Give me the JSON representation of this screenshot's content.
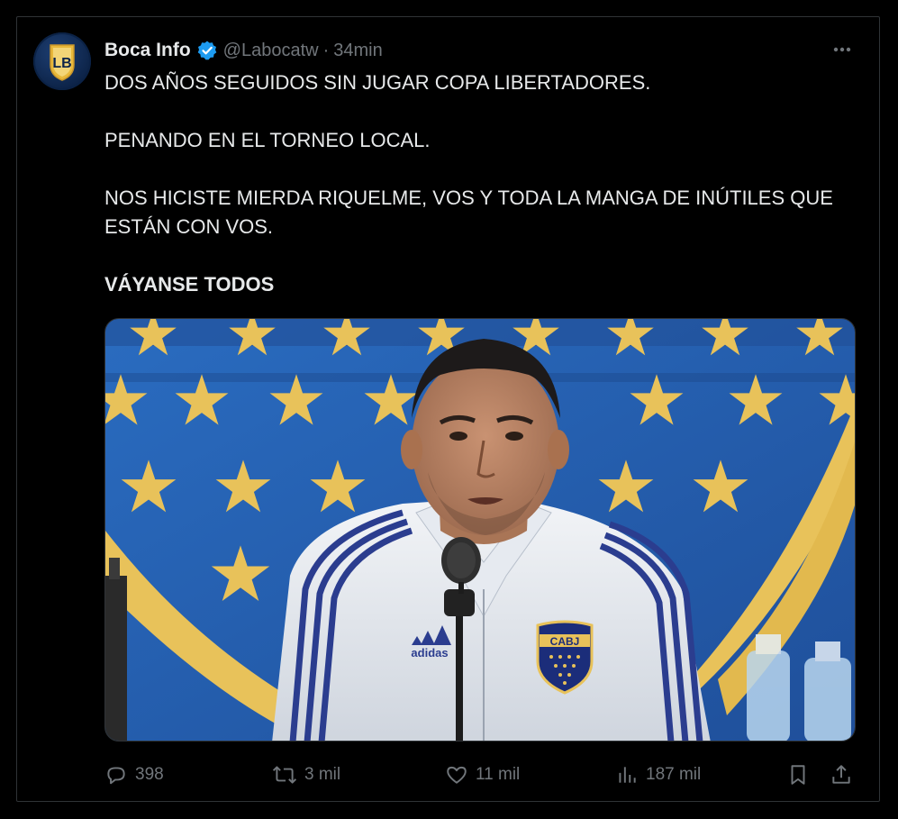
{
  "tweet": {
    "author": {
      "display_name": "Boca Info",
      "handle": "@Labocatw",
      "separator": "·",
      "time": "34min",
      "avatar_letters": "LB",
      "verified": true
    },
    "text": {
      "line1": "DOS AÑOS SEGUIDOS SIN JUGAR COPA LIBERTADORES.",
      "line2": "PENANDO EN EL TORNEO LOCAL.",
      "line3": "NOS HICISTE MIERDA RIQUELME, VOS Y TODA LA MANGA DE INÚTILES QUE ESTÁN CON VOS.",
      "line4": "VÁYANSE TODOS"
    },
    "media": {
      "jacket_brand": "adidas",
      "crest_text": "CABJ"
    },
    "actions": {
      "replies": "398",
      "reposts": "3 mil",
      "likes": "11 mil",
      "views": "187 mil"
    }
  },
  "colors": {
    "background": "#000000",
    "text": "#e7e9ea",
    "muted": "#71767b",
    "verified": "#1d9bf0",
    "boca_blue": "#2563b0",
    "boca_gold": "#e8c25a"
  },
  "icons": {
    "more": "more-icon",
    "reply": "reply-icon",
    "repost": "repost-icon",
    "like": "heart-icon",
    "views": "views-icon",
    "bookmark": "bookmark-icon",
    "share": "share-icon"
  }
}
